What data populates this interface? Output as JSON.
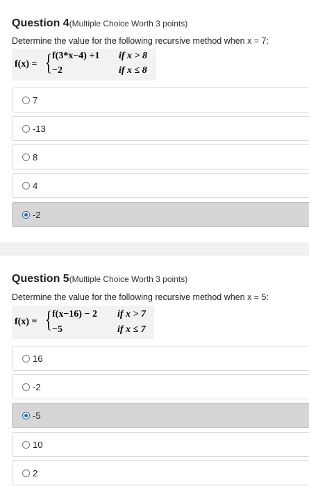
{
  "question4": {
    "title": "Question 4",
    "meta": "(Multiple Choice Worth 3 points)",
    "prompt": "Determine the value for the following recursive method when x = 7:",
    "formula": {
      "lhs": "f(x) =",
      "case1_expr": "f(3*x−4) +1",
      "case1_cond": "if x > 8",
      "case2_expr": "−2",
      "case2_cond": "if x ≤ 8"
    },
    "options": [
      {
        "label": "7",
        "selected": false
      },
      {
        "label": "-13",
        "selected": false
      },
      {
        "label": "8",
        "selected": false
      },
      {
        "label": "4",
        "selected": false
      },
      {
        "label": "-2",
        "selected": true
      }
    ]
  },
  "question5": {
    "title": "Question 5",
    "meta": "(Multiple Choice Worth 3 points)",
    "prompt": "Determine the value for the following recursive method when x = 5:",
    "formula": {
      "lhs": "f(x) =",
      "case1_expr": "f(x−16) − 2",
      "case1_cond": "if x > 7",
      "case2_expr": "−5",
      "case2_cond": "if x ≤ 7"
    },
    "options": [
      {
        "label": "16",
        "selected": false
      },
      {
        "label": "-2",
        "selected": false
      },
      {
        "label": "-5",
        "selected": true
      },
      {
        "label": "10",
        "selected": false
      },
      {
        "label": "2",
        "selected": false
      }
    ]
  },
  "colors": {
    "page_background": "#f0f0f0",
    "card_background": "#ffffff",
    "selected_option": "#d6d6d6",
    "radio_checked": "#2b66c3"
  }
}
